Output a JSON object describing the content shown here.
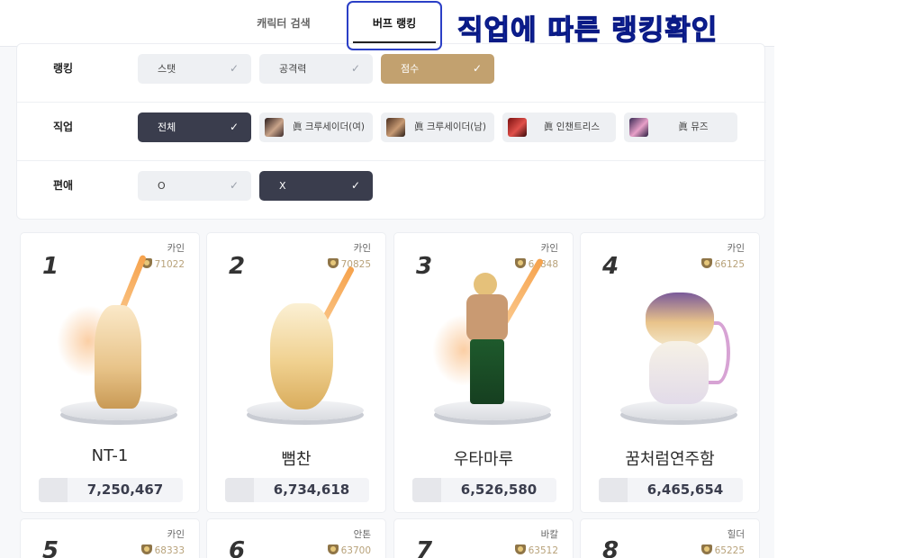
{
  "tabs": [
    {
      "label": "캐릭터 검색"
    },
    {
      "label": "버프 랭킹"
    }
  ],
  "annotation": "직업에 따른 랭킹확인",
  "filters": {
    "ranking": {
      "label": "랭킹",
      "options": [
        "스탯",
        "공격력",
        "점수"
      ],
      "selected": "점수"
    },
    "job": {
      "label": "직업",
      "options": [
        "전체",
        "眞 크루세이더(여)",
        "眞 크루세이더(남)",
        "眞 인챈트리스",
        "眞 뮤즈"
      ],
      "selected": "전체"
    },
    "favorite": {
      "label": "편애",
      "options": [
        "O",
        "X"
      ],
      "selected": "X"
    }
  },
  "check_icon": "✓",
  "cards": [
    {
      "rank": "1",
      "server": "카인",
      "score": "71022",
      "name": "NT-1",
      "buff": "7,250,467"
    },
    {
      "rank": "2",
      "server": "카인",
      "score": "70825",
      "name": "뻠찬",
      "buff": "6,734,618"
    },
    {
      "rank": "3",
      "server": "카인",
      "score": "64848",
      "name": "우타마루",
      "buff": "6,526,580"
    },
    {
      "rank": "4",
      "server": "카인",
      "score": "66125",
      "name": "꿈처럼연주함",
      "buff": "6,465,654"
    },
    {
      "rank": "5",
      "server": "카인",
      "score": "68333"
    },
    {
      "rank": "6",
      "server": "안톤",
      "score": "63700"
    },
    {
      "rank": "7",
      "server": "바칼",
      "score": "63512"
    },
    {
      "rank": "8",
      "server": "힐더",
      "score": "65225"
    }
  ],
  "colors": {
    "accent_gold": "#c2a16f",
    "selected_dark": "#3a3d4d",
    "annotation_blue": "#1d3dd6"
  }
}
